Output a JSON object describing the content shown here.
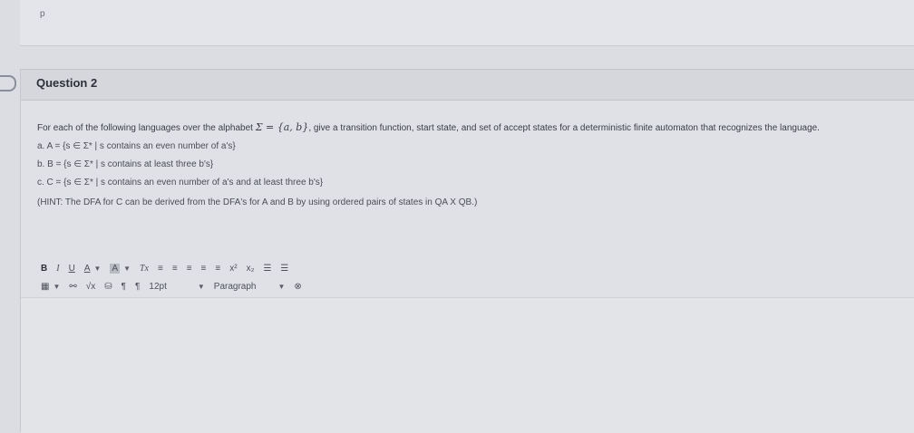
{
  "prev_card": {
    "label": "p"
  },
  "question": {
    "title": "Question 2",
    "prompt_pre": "For each of the following languages over the alphabet",
    "prompt_math": "Σ = {a, b}",
    "prompt_post": ", give a transition function, start state, and set of accept states for a deterministic finite automaton that recognizes the language.",
    "parts": [
      "a. A = {s ∈ Σ* | s contains an even number of a's}",
      "b. B = {s ∈ Σ* | s contains at least three b's}",
      "c. C = {s ∈ Σ* | s contains an even number of a's and at least three b's}"
    ],
    "hint": "(HINT: The DFA for C can be derived from the DFA's for A and B by using ordered pairs of states in QA X QB.)"
  },
  "toolbar": {
    "bold": "B",
    "italic": "I",
    "underline": "U",
    "font_color": "A",
    "highlight": "A",
    "clear_format": "Tx",
    "align_left": "≡",
    "align_center": "≡",
    "align_right": "≡",
    "align_justify": "≡",
    "indent": "≡",
    "superscript": "x²",
    "subscript": "x₂",
    "bullet_list": "☰",
    "numbered_list": "☰",
    "table": "▦",
    "unlink": "⚯",
    "equation": "√x",
    "media": "⛁",
    "ltr": "¶",
    "rtl": "¶",
    "font_size": "12pt",
    "paragraph_style": "Paragraph",
    "more": "⊗"
  }
}
